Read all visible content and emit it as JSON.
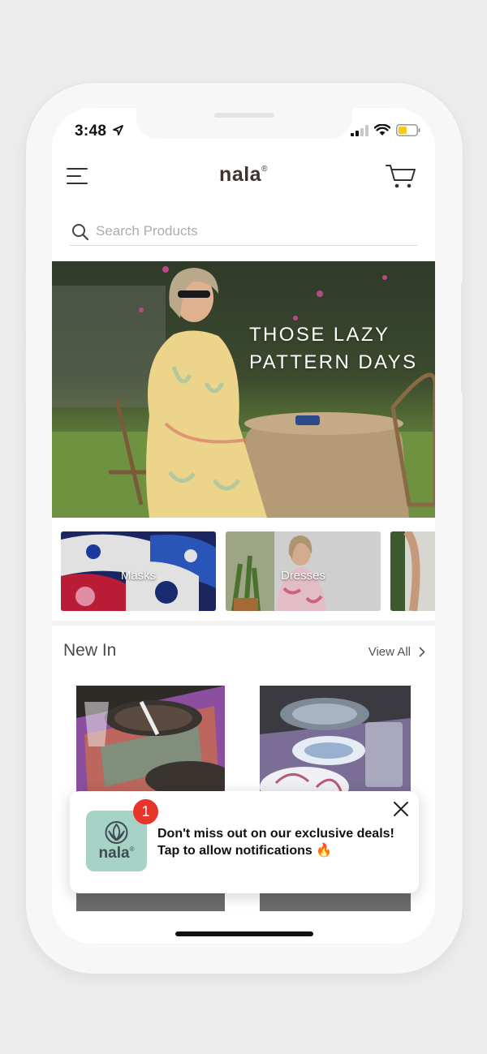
{
  "status_bar": {
    "time": "3:48"
  },
  "header": {
    "brand": "nala",
    "brand_mark": "®"
  },
  "search": {
    "placeholder": "Search Products",
    "value": ""
  },
  "hero": {
    "title_line1": "THOSE LAZY",
    "title_line2": "PATTERN DAYS"
  },
  "categories": [
    {
      "label": "Masks"
    },
    {
      "label": "Dresses"
    },
    {
      "label": ""
    }
  ],
  "new_in": {
    "title": "New In",
    "view_all": "View All"
  },
  "notification": {
    "badge": "1",
    "logo_text": "nala",
    "logo_mark": "®",
    "line1": "Don't miss out on our exclusive deals!",
    "line2": "Tap to allow notifications",
    "emoji": "🔥"
  },
  "colors": {
    "brand_text": "#3f3230",
    "logo_bg": "#a7d3c7",
    "badge": "#e8342a",
    "battery": "#f4cc1a"
  }
}
